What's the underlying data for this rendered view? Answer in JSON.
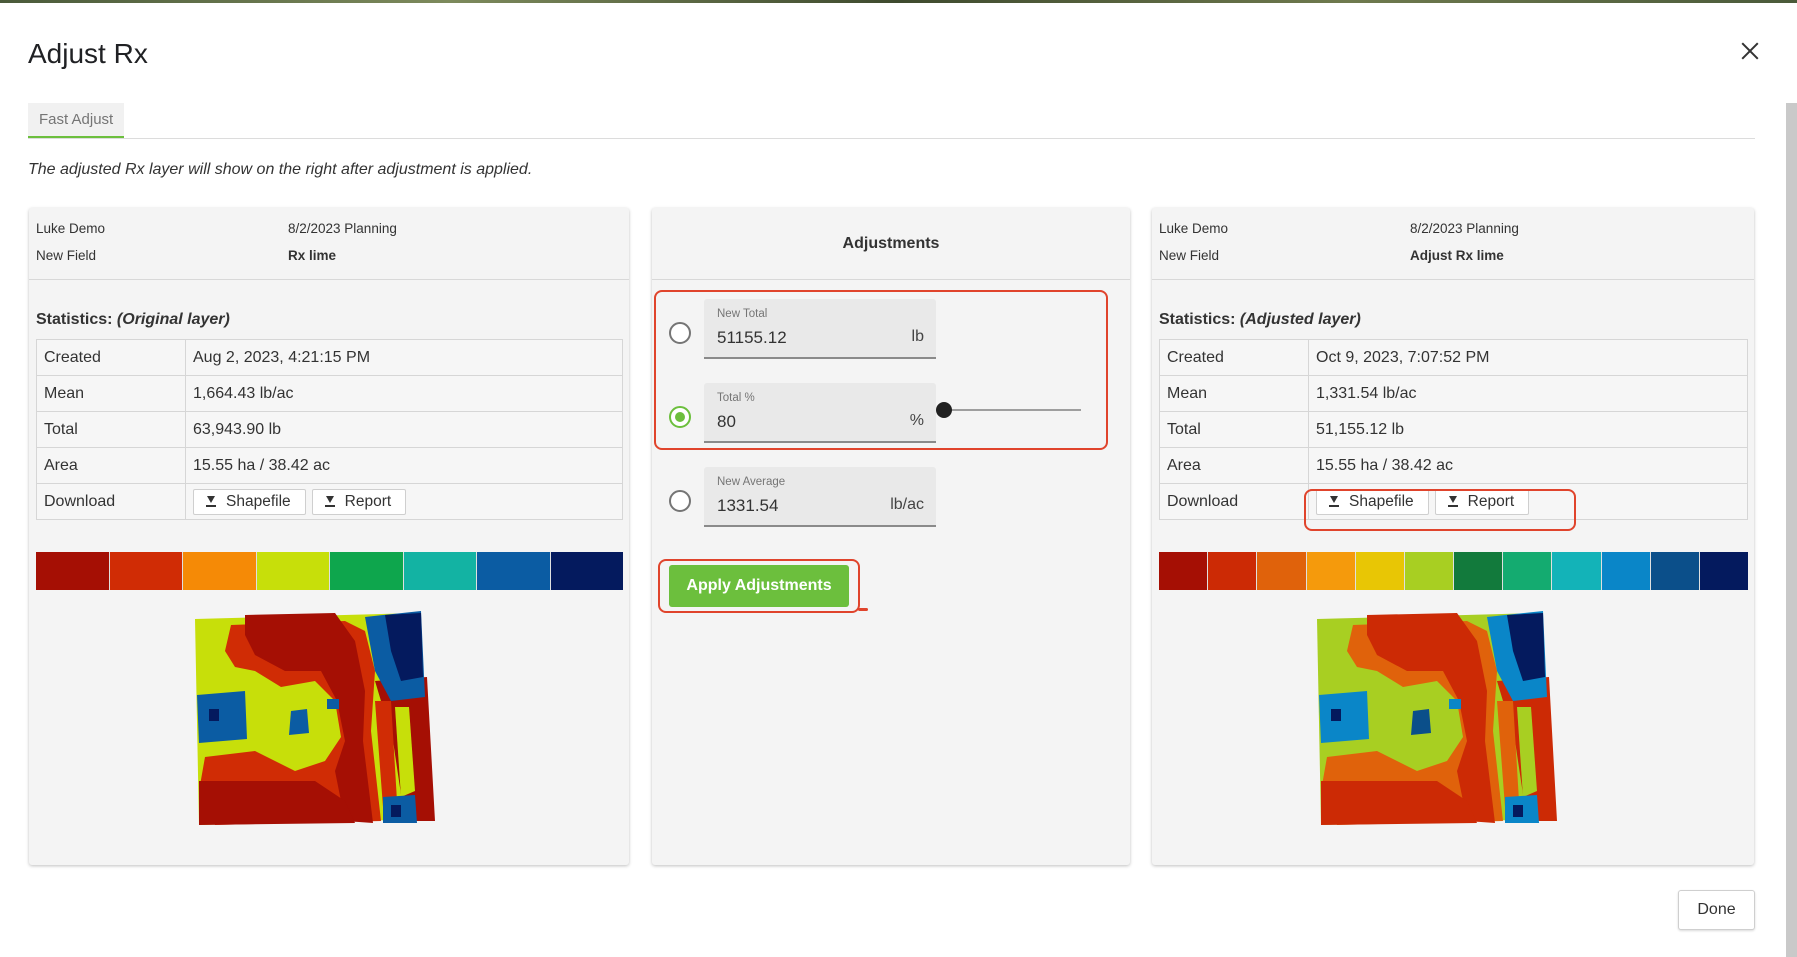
{
  "dialog": {
    "title": "Adjust Rx",
    "close_icon": "close-icon"
  },
  "tabs": [
    {
      "label": "Fast Adjust",
      "active": true
    }
  ],
  "note": "The adjusted Rx layer will show on the right after adjustment is applied.",
  "left": {
    "owner": "Luke Demo",
    "plan": "8/2/2023 Planning",
    "field": "New Field",
    "layer": "Rx lime",
    "stats_label": "Statistics:",
    "stats_sub": "(Original layer)",
    "rows": {
      "created_k": "Created",
      "created_v": "Aug 2, 2023, 4:21:15 PM",
      "mean_k": "Mean",
      "mean_v": "1,664.43 lb/ac",
      "total_k": "Total",
      "total_v": "63,943.90 lb",
      "area_k": "Area",
      "area_v": "15.55 ha / 38.42 ac",
      "download_k": "Download"
    },
    "shapefile_label": "Shapefile",
    "report_label": "Report",
    "legend_colors": [
      "#a50f04",
      "#d02c05",
      "#f58a06",
      "#c7df0a",
      "#0ea64d",
      "#13b3a3",
      "#0b5ca3",
      "#041a5e"
    ]
  },
  "middle": {
    "title": "Adjustments",
    "new_total": {
      "label": "New Total",
      "value": "51155.12",
      "unit": "lb",
      "selected": false
    },
    "total_pct": {
      "label": "Total %",
      "value": "80",
      "unit": "%",
      "selected": true
    },
    "new_average": {
      "label": "New Average",
      "value": "1331.54",
      "unit": "lb/ac",
      "selected": false
    },
    "slider_value": 0,
    "apply_label": "Apply Adjustments"
  },
  "right": {
    "owner": "Luke Demo",
    "plan": "8/2/2023 Planning",
    "field": "New Field",
    "layer": "Adjust Rx lime",
    "stats_label": "Statistics:",
    "stats_sub": "(Adjusted layer)",
    "rows": {
      "created_k": "Created",
      "created_v": "Oct 9, 2023, 7:07:52 PM",
      "mean_k": "Mean",
      "mean_v": "1,331.54 lb/ac",
      "total_k": "Total",
      "total_v": "51,155.12 lb",
      "area_k": "Area",
      "area_v": "15.55 ha / 38.42 ac",
      "download_k": "Download"
    },
    "shapefile_label": "Shapefile",
    "report_label": "Report",
    "legend_colors": [
      "#a50f04",
      "#cc2a05",
      "#e0620b",
      "#f59a0c",
      "#e8c605",
      "#a8cf22",
      "#127a3c",
      "#14ab70",
      "#13b3b8",
      "#0a86c8",
      "#0b4f8a",
      "#041a5e"
    ]
  },
  "footer": {
    "done_label": "Done"
  }
}
